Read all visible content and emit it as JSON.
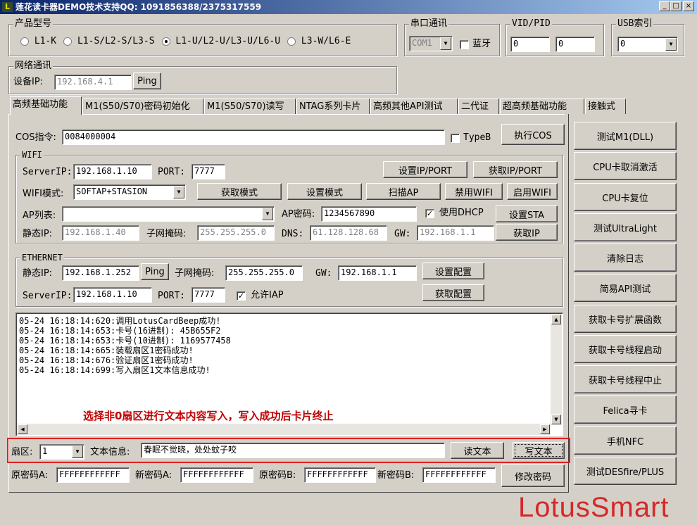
{
  "title": "莲花读卡器DEMO技术支持QQ: 1091856388/2375317559",
  "window_buttons": {
    "minimize": "_",
    "maximize": "□",
    "close": "×"
  },
  "product": {
    "label": "产品型号",
    "options": [
      "L1-K",
      "L1-S/L2-S/L3-S",
      "L1-U/L2-U/L3-U/L6-U",
      "L3-W/L6-E"
    ],
    "selected": 2
  },
  "serial": {
    "label": "串口通讯",
    "port": "COM1",
    "bluetooth_label": "蓝牙"
  },
  "vidpid": {
    "label": "VID/PID",
    "vid": "0",
    "pid": "0"
  },
  "usb": {
    "label": "USB索引",
    "value": "0"
  },
  "network": {
    "label": "网络通讯",
    "device_ip_label": "设备IP:",
    "device_ip": "192.168.4.1",
    "ping": "Ping"
  },
  "tabs": [
    "高频基础功能",
    "M1(S50/S70)密码初始化",
    "M1(S50/S70)读写",
    "NTAG系列卡片",
    "高频其他API测试",
    "二代证",
    "超高频基础功能",
    "接触式"
  ],
  "cos": {
    "label": "COS指令:",
    "value": "0084000004",
    "typeb": "TypeB",
    "exec": "执行COS"
  },
  "wifi": {
    "label": "WIFI",
    "server_ip_label": "ServerIP:",
    "server_ip": "192.168.1.10",
    "port_label": "PORT:",
    "port": "7777",
    "set_ipport": "设置IP/PORT",
    "get_ipport": "获取IP/PORT",
    "mode_label": "WIFI模式:",
    "mode": "SOFTAP+STASION",
    "get_mode": "获取模式",
    "set_mode": "设置模式",
    "scan_ap": "扫描AP",
    "disable": "禁用WIFI",
    "enable": "启用WIFI",
    "ap_list_label": "AP列表:",
    "ap_list": "",
    "ap_pwd_label": "AP密码:",
    "ap_pwd": "1234567890",
    "dhcp_label": "使用DHCP",
    "set_sta": "设置STA",
    "static_ip_label": "静态IP:",
    "static_ip": "192.168.1.40",
    "mask_label": "子网掩码:",
    "mask": "255.255.255.0",
    "dns_label": "DNS:",
    "dns": "61.128.128.68",
    "gw_label": "GW:",
    "gw": "192.168.1.1",
    "get_ip": "获取IP"
  },
  "ethernet": {
    "label": "ETHERNET",
    "static_ip_label": "静态IP:",
    "static_ip": "192.168.1.252",
    "ping": "Ping",
    "mask_label": "子网掩码:",
    "mask": "255.255.255.0",
    "gw_label": "GW:",
    "gw": "192.168.1.1",
    "set_config": "设置配置",
    "server_ip_label": "ServerIP:",
    "server_ip": "192.168.1.10",
    "port_label": "PORT:",
    "port": "7777",
    "allow_iap": "允许IAP",
    "get_config": "获取配置"
  },
  "log": [
    "05-24 16:18:14:620:调用LotusCardBeep成功!",
    "05-24 16:18:14:653:卡号(16进制): 45B655F2",
    "05-24 16:18:14:653:卡号(10进制): 1169577458",
    "05-24 16:18:14:665:装载扇区1密码成功!",
    "05-24 16:18:14:676:验证扇区1密码成功!",
    "05-24 16:18:14:699:写入扇区1文本信息成功!"
  ],
  "annotation": {
    "text": "选择非0扇区进行文本内容写入，写入成功后卡片终止",
    "color": "#c00000"
  },
  "sector": {
    "label": "扇区:",
    "value": "1",
    "text_label": "文本信息:",
    "text": "春眠不觉晓，处处蚊子咬",
    "read": "读文本",
    "write": "写文本"
  },
  "passwords": {
    "a_old_label": "原密码A:",
    "a_old": "FFFFFFFFFFFF",
    "a_new_label": "新密码A:",
    "a_new": "FFFFFFFFFFFF",
    "b_old_label": "原密码B:",
    "b_old": "FFFFFFFFFFFF",
    "b_new_label": "新密码B:",
    "b_new": "FFFFFFFFFFFF",
    "modify": "修改密码"
  },
  "right_buttons": [
    "测试M1(DLL)",
    "CPU卡取消激活",
    "CPU卡复位",
    "测试UltraLight",
    "清除日志",
    "简易API测试",
    "获取卡号扩展函数",
    "获取卡号线程启动",
    "获取卡号线程中止",
    "Felica寻卡",
    "手机NFC",
    "测试DESfire/PLUS"
  ],
  "watermark": "LotusSmart",
  "colors": {
    "title_start": "#0a246a",
    "title_end": "#a6caf0",
    "face": "#d4d0c8",
    "highlight": "#e02020",
    "watermark": "#d62828"
  }
}
